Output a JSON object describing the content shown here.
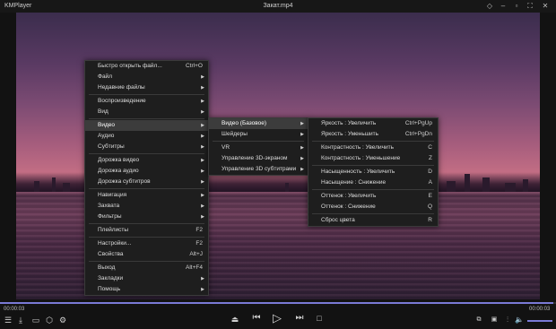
{
  "window": {
    "app_name": "KMPlayer",
    "file_name": "Закат.mp4"
  },
  "main_menu": [
    {
      "label": "Быстро открыть файл...",
      "shortcut": "Ctrl+O"
    },
    {
      "label": "Файл",
      "submenu": true
    },
    {
      "label": "Недавние файлы",
      "submenu": true
    },
    {
      "separator": true
    },
    {
      "label": "Воспроизведение",
      "submenu": true
    },
    {
      "label": "Вид",
      "submenu": true
    },
    {
      "separator": true
    },
    {
      "label": "Видео",
      "submenu": true,
      "active": true
    },
    {
      "label": "Аудио",
      "submenu": true
    },
    {
      "label": "Субтитры",
      "submenu": true
    },
    {
      "separator": true
    },
    {
      "label": "Дорожка видео",
      "submenu": true
    },
    {
      "label": "Дорожка аудио",
      "submenu": true
    },
    {
      "label": "Дорожка субтитров",
      "submenu": true
    },
    {
      "separator": true
    },
    {
      "label": "Навигация",
      "submenu": true
    },
    {
      "label": "Захвата",
      "submenu": true
    },
    {
      "label": "Фильтры",
      "submenu": true
    },
    {
      "separator": true
    },
    {
      "label": "Плейлисты",
      "shortcut": "F2"
    },
    {
      "separator": true
    },
    {
      "label": "Настройки...",
      "shortcut": "F2"
    },
    {
      "label": "Свойства",
      "shortcut": "Alt+J"
    },
    {
      "separator": true
    },
    {
      "label": "Выход",
      "shortcut": "Alt+F4"
    },
    {
      "label": "Закладки",
      "submenu": true
    },
    {
      "label": "Помощь",
      "submenu": true
    }
  ],
  "video_menu": [
    {
      "label": "Видео (Базовое)",
      "submenu": true,
      "active": true
    },
    {
      "label": "Шейдеры",
      "submenu": true
    },
    {
      "separator": true
    },
    {
      "label": "VR",
      "submenu": true
    },
    {
      "label": "Управление 3D-экраном",
      "submenu": true
    },
    {
      "label": "Управление 3D субтитрами",
      "submenu": true
    }
  ],
  "basic_menu": [
    {
      "label": "Яркость : Увеличить",
      "shortcut": "Ctrl+PgUp"
    },
    {
      "label": "Яркость : Уменьшить",
      "shortcut": "Ctrl+PgDn"
    },
    {
      "separator": true
    },
    {
      "label": "Контрастность : Увеличить",
      "shortcut": "C"
    },
    {
      "label": "Контрастность : Уменьшение",
      "shortcut": "Z"
    },
    {
      "separator": true
    },
    {
      "label": "Насыщенность : Увеличить",
      "shortcut": "D"
    },
    {
      "label": "Насыщение : Снижение",
      "shortcut": "A"
    },
    {
      "separator": true
    },
    {
      "label": "Оттенок : Увеличить",
      "shortcut": "E"
    },
    {
      "label": "Оттенок : Снижение",
      "shortcut": "Q"
    },
    {
      "separator": true
    },
    {
      "label": "Сброс цвета",
      "shortcut": "R"
    }
  ],
  "player": {
    "elapsed": "00:00:03",
    "duration": "00:00:03",
    "progress_fraction": 0.995,
    "volume_fraction": 1.0,
    "accent_color": "#7a7ad6"
  },
  "icons": {
    "title_controls": [
      "pin-icon",
      "minimize-icon",
      "maximize-icon",
      "fullscreen-icon",
      "close-icon"
    ],
    "left_controls": [
      "playlist-icon",
      "download-icon",
      "subtitle-icon",
      "cube-3d-icon",
      "settings-icon"
    ],
    "center_controls": [
      "eject-icon",
      "previous-icon",
      "play-icon",
      "next-icon",
      "stop-icon"
    ],
    "right_controls": [
      "vr-icon",
      "fullscreen-toggle-icon",
      "equalizer-icon",
      "volume-icon"
    ]
  }
}
